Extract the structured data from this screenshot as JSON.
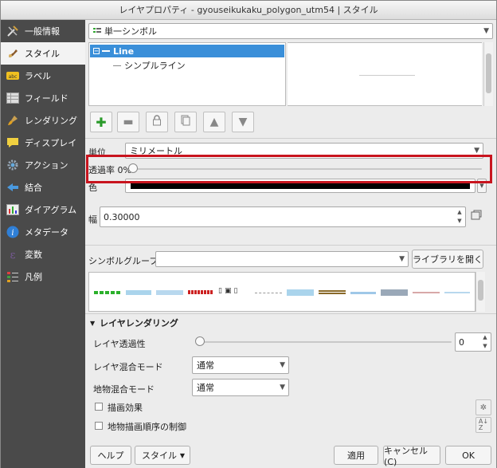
{
  "window": {
    "title": "レイヤプロパティ - gyouseikukaku_polygon_utm54 | スタイル"
  },
  "sidebar": {
    "items": [
      {
        "label": "一般情報",
        "icon": "tools-icon"
      },
      {
        "label": "スタイル",
        "icon": "brush-icon"
      },
      {
        "label": "ラベル",
        "icon": "label-abc-icon"
      },
      {
        "label": "フィールド",
        "icon": "table-icon"
      },
      {
        "label": "レンダリング",
        "icon": "paintbrush-icon"
      },
      {
        "label": "ディスプレイ",
        "icon": "speech-bubble-icon"
      },
      {
        "label": "アクション",
        "icon": "gear-icon"
      },
      {
        "label": "結合",
        "icon": "join-icon"
      },
      {
        "label": "ダイアグラム",
        "icon": "diagram-icon"
      },
      {
        "label": "メタデータ",
        "icon": "info-icon"
      },
      {
        "label": "変数",
        "icon": "variable-icon"
      },
      {
        "label": "凡例",
        "icon": "legend-icon"
      }
    ],
    "active_index": 1
  },
  "renderer": {
    "value": "単一シンボル"
  },
  "tree": {
    "root": "Line",
    "child": "シンプルライン"
  },
  "toolbar": {
    "add": "add-layer-icon",
    "remove": "remove-layer-icon",
    "lock": "lock-icon",
    "duplicate": "duplicate-icon",
    "up": "move-up-icon",
    "down": "move-down-icon"
  },
  "unit": {
    "label": "単位",
    "value": "ミリメートル"
  },
  "opacity": {
    "label": "透過率 0%",
    "value": 0
  },
  "color": {
    "label": "色",
    "swatch": "#000000"
  },
  "width": {
    "label": "幅",
    "value": "0.30000"
  },
  "symbol_group": {
    "label": "シンボルグループ",
    "value": "",
    "open_library": "ライブラリを開く"
  },
  "layer_rendering": {
    "header": "レイヤレンダリング",
    "transparency_label": "レイヤ透過性",
    "transparency_value": "0",
    "blend_layer_label": "レイヤ混合モード",
    "blend_layer_value": "通常",
    "blend_feature_label": "地物混合モード",
    "blend_feature_value": "通常",
    "draw_effects": "描画効果",
    "feature_order": "地物描画順序の制御"
  },
  "buttons": {
    "help": "ヘルプ",
    "style": "スタイル",
    "apply": "適用",
    "cancel": "キャンセル(C)",
    "ok": "OK"
  },
  "colors": {
    "highlight": "#c8141e",
    "selection": "#3a8fd9",
    "sidebar_bg": "#4a4a4a"
  }
}
